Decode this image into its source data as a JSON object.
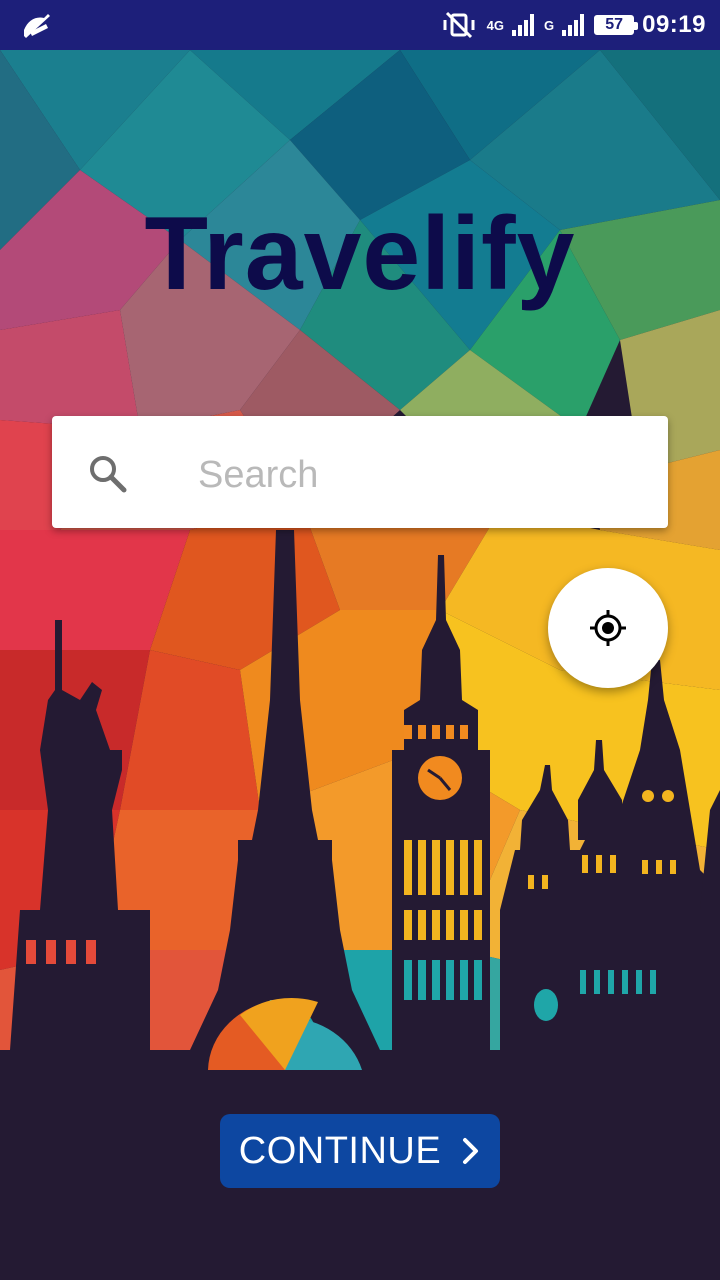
{
  "status_bar": {
    "network_1": "4G",
    "network_2": "G",
    "battery": "57",
    "time": "09:19"
  },
  "app": {
    "title": "Travelify"
  },
  "search": {
    "placeholder": "Search",
    "value": ""
  },
  "actions": {
    "continue_label": "CONTINUE"
  },
  "icons": {
    "status_left": "notification-off-icon",
    "search": "search-icon",
    "location": "my-location-icon",
    "continue": "chevron-right-icon"
  },
  "colors": {
    "status_bar": "#1d1f7a",
    "title": "#0d0b4a",
    "button": "#0d47a1",
    "silhouette": "#241a33"
  }
}
